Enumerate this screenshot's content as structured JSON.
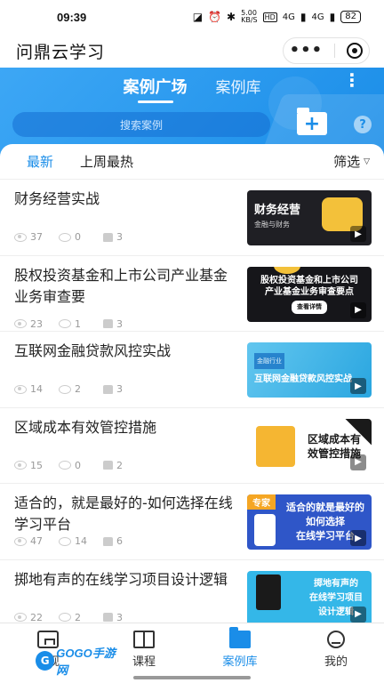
{
  "status_bar": {
    "time": "09:39",
    "net_speed": "5.00\nKB/S",
    "hd_badge": "HD",
    "signal1": "4G",
    "signal2": "4G",
    "battery": "82"
  },
  "app": {
    "title": "问鼎云学习"
  },
  "top_tabs": [
    {
      "label": "案例广场",
      "active": true
    },
    {
      "label": "案例库",
      "active": false
    }
  ],
  "search": {
    "placeholder": "搜索案例"
  },
  "help_label": "?",
  "filter_tabs": [
    {
      "label": "最新",
      "active": true
    },
    {
      "label": "上周最热",
      "active": false
    }
  ],
  "filter_label": "筛选",
  "cases": [
    {
      "title": "财务经营实战",
      "views": "37",
      "comments": "0",
      "likes": "3",
      "cover_text": "财务经营",
      "cover_sub": "金融与财务"
    },
    {
      "title": "股权投资基金和上市公司产业基金业务审查要",
      "views": "23",
      "comments": "1",
      "likes": "3",
      "cover_text": "股权投资基金和上市公司\n产业基金业务审查要点",
      "cover_sub": "查看详情"
    },
    {
      "title": "互联网金融贷款风控实战",
      "views": "14",
      "comments": "2",
      "likes": "3",
      "cover_text": "互联网金融贷款风控实战",
      "cover_sub": "金融行业"
    },
    {
      "title": "区域成本有效管控措施",
      "views": "15",
      "comments": "0",
      "likes": "2",
      "cover_text": "区域成本有\n效管控措施",
      "cover_sub": ""
    },
    {
      "title": "适合的，就是最好的-如何选择在线学习平台",
      "views": "47",
      "comments": "14",
      "likes": "6",
      "cover_text": "适合的就是最好的\n如何选择\n在线学习平台",
      "cover_sub": "专家"
    },
    {
      "title": "掷地有声的在线学习项目设计逻辑",
      "views": "22",
      "comments": "2",
      "likes": "3",
      "cover_text": "掷地有声的\n在线学习项目\n设计逻辑",
      "cover_sub": ""
    }
  ],
  "bottom_nav": [
    {
      "label": "发现",
      "icon": "home-icon",
      "active": false
    },
    {
      "label": "课程",
      "icon": "book-icon",
      "active": false
    },
    {
      "label": "案例库",
      "icon": "folder-icon",
      "active": true
    },
    {
      "label": "我的",
      "icon": "user-icon",
      "active": false
    }
  ],
  "watermark": {
    "logo": "G",
    "text": "GOGO手游网"
  },
  "colors": {
    "accent": "#1a8de8",
    "banner_start": "#3da7f5",
    "banner_end": "#1a8de8"
  }
}
